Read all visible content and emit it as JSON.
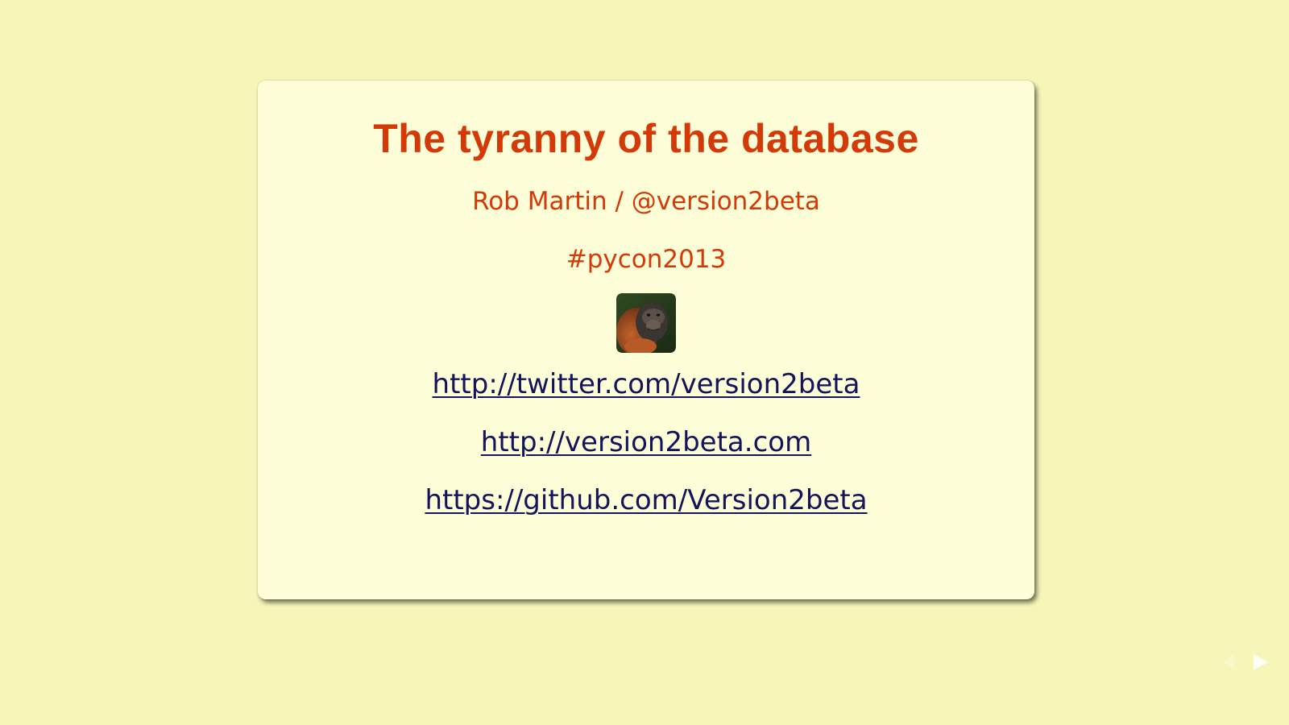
{
  "slide": {
    "title": "The tyranny of the database",
    "subtitle": "Rob Martin / @version2beta",
    "hashtag": "#pycon2013",
    "avatar_icon": "orangutan-avatar",
    "links": [
      {
        "label": "http://twitter.com/version2beta"
      },
      {
        "label": "http://version2beta.com"
      },
      {
        "label": "https://github.com/Version2beta"
      }
    ]
  },
  "controls": {
    "next_icon": "arrow-right-icon",
    "prev_icon": "arrow-left-icon"
  },
  "colors": {
    "background": "#f6f6b8",
    "card": "#fdfdd8",
    "accent": "#d43a08",
    "link": "#13145a"
  }
}
